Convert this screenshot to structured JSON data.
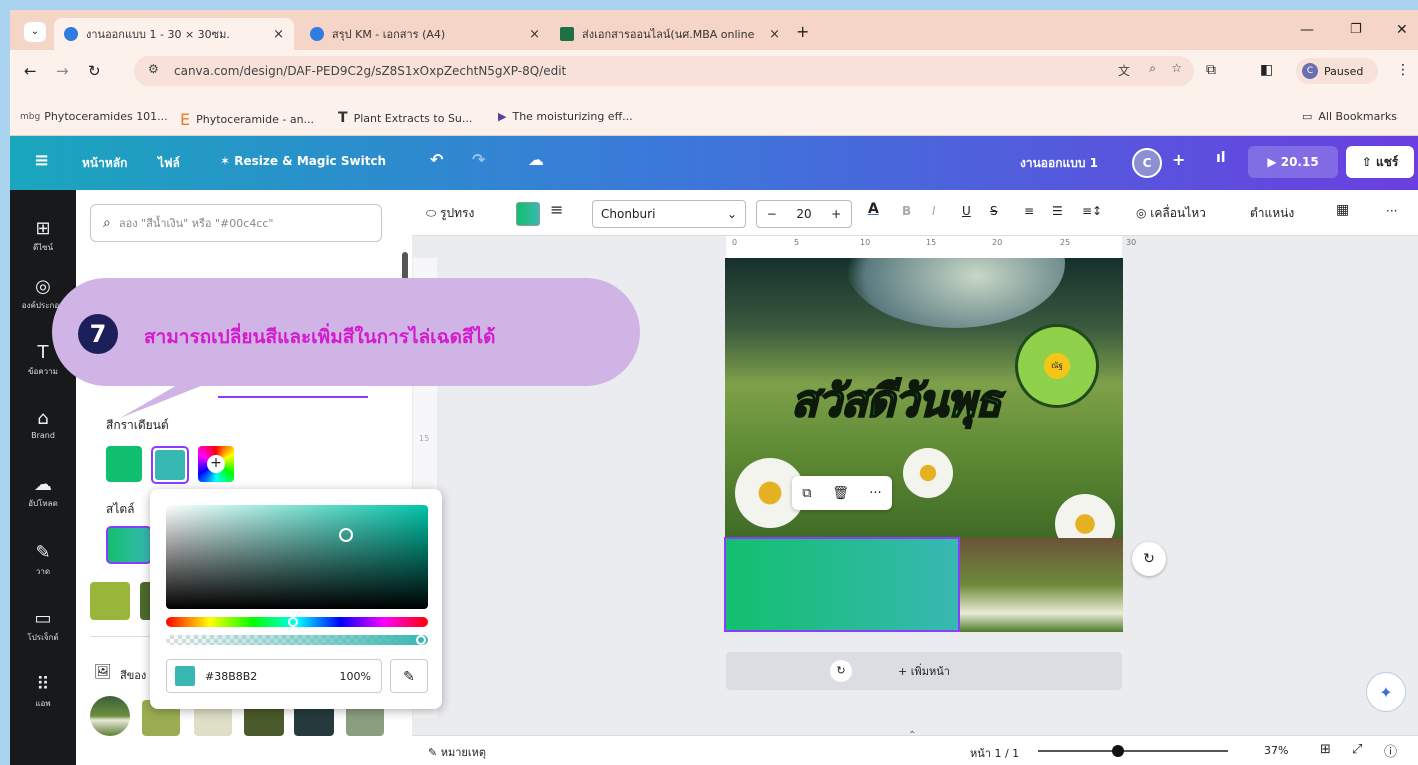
{
  "browser": {
    "tabs": [
      {
        "label": "งานออกแบบ 1 - 30 × 30ซม.",
        "close": "×"
      },
      {
        "label": "สรุป KM - เอกสาร (A4)",
        "close": "×"
      },
      {
        "label": "ส่งเอกสารออนไลน์(นศ.MBA online",
        "close": "×"
      }
    ],
    "new_tab": "+",
    "url": "canva.com/design/DAF-PED9C2g/sZ8S1xOxpZechtN5gXP-8Q/edit",
    "profile_status": "Paused",
    "bookmarks": [
      "Phytoceramides 101...",
      "Phytoceramide - an...",
      "Plant Extracts to Su...",
      "The moisturizing eff..."
    ],
    "all_bookmarks": "All Bookmarks"
  },
  "canva": {
    "menu": [
      "หน้าหลัก",
      "ไฟล์",
      "Resize & Magic Switch"
    ],
    "doc_title": "งานออกแบบ 1",
    "avatar": "C",
    "timer": "20.15",
    "share": "แชร์"
  },
  "leftnav": [
    "ดีไซน์",
    "องค์ประกอบ",
    "ข้อความ",
    "Brand",
    "อัปโหลด",
    "วาด",
    "โปรเจ็กต์",
    "แอพ"
  ],
  "panel": {
    "search_placeholder": "ลอง \"สีน้ำเงิน\" หรือ \"#00c4cc\"",
    "gradient_title": "สีกราเดียนต์",
    "style_title": "สไตล์",
    "photo_colors_title": "สีของ",
    "colors": {
      "gradient_a": "#12bf6e",
      "gradient_b": "#38b8b2"
    }
  },
  "toolbar": {
    "shape": "รูปทรง",
    "font": "Chonburi",
    "font_size": "20",
    "animate": "เคลื่อนไหว",
    "position": "ตำแหน่ง"
  },
  "ruler_ticks": [
    "0",
    "5",
    "10",
    "15",
    "20",
    "25",
    "30"
  ],
  "vruler_tick": "15",
  "design": {
    "title_text": "สวัสดีวันพุธ",
    "flower_text": "ณัฐ"
  },
  "add_page": "+ เพิ่มหน้า",
  "bottom": {
    "notes": "หมายเหตุ",
    "page": "หน้า 1 / 1",
    "zoom": "37%"
  },
  "picker": {
    "hex": "#38B8B2",
    "opacity": "100%"
  },
  "callout": {
    "number": "7",
    "text": "สามารถเปลี่ยนสีและเพิ่มสีในการไล่เฉดสีได้"
  }
}
